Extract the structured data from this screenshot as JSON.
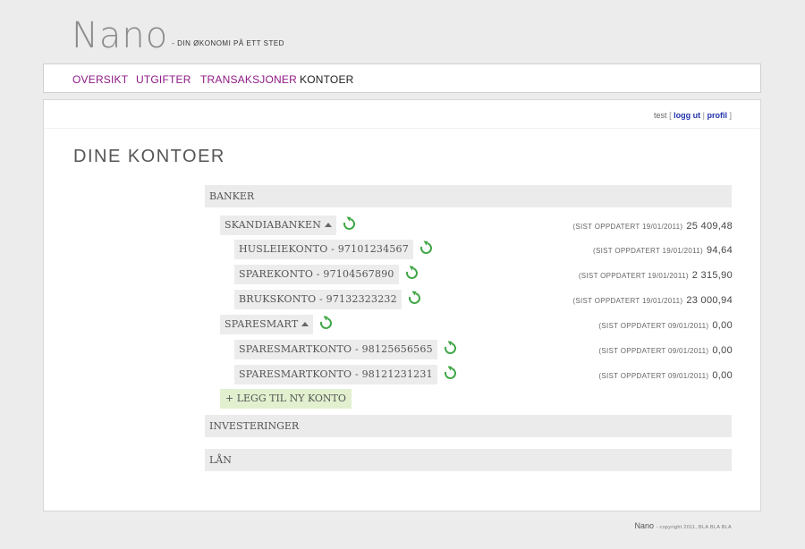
{
  "brand": {
    "name": "Nano",
    "tagline": "- DIN ØKONOMI PÅ ETT STED"
  },
  "nav": [
    {
      "label": "OVERSIKT",
      "active": false
    },
    {
      "label": "UTGIFTER",
      "active": false
    },
    {
      "label": "TRANSAKSJONER",
      "active": false
    },
    {
      "label": "KONTOER",
      "active": true
    }
  ],
  "user": {
    "name": "test",
    "logout": "logg ut",
    "profile": "profil",
    "open": "[",
    "sep": "|",
    "close": "]"
  },
  "page_title": "DINE KONTOER",
  "sections": {
    "banks": "BANKER",
    "investments": "INVESTERINGER",
    "loans": "LÅN"
  },
  "banks": [
    {
      "name": "SKANDIABANKEN",
      "updated": "(SIST OPPDATERT 19/01/2011)",
      "amount": "25 409,48",
      "accounts": [
        {
          "name": "HUSLEIEKONTO - 97101234567",
          "updated": "(SIST OPPDATERT 19/01/2011)",
          "amount": "94,64"
        },
        {
          "name": "SPAREKONTO - 97104567890",
          "updated": "(SIST OPPDATERT 19/01/2011)",
          "amount": "2 315,90"
        },
        {
          "name": "BRUKSKONTO - 97132323232",
          "updated": "(SIST OPPDATERT 19/01/2011)",
          "amount": "23 000,94"
        }
      ]
    },
    {
      "name": "SPARESMART",
      "updated": "(SIST OPPDATERT 09/01/2011)",
      "amount": "0,00",
      "accounts": [
        {
          "name": "SPARESMARTKONTO - 98125656565",
          "updated": "(SIST OPPDATERT 09/01/2011)",
          "amount": "0,00"
        },
        {
          "name": "SPARESMARTKONTO - 98121231231",
          "updated": "(SIST OPPDATERT 09/01/2011)",
          "amount": "0,00"
        }
      ]
    }
  ],
  "add_account": "+ LEGG TIL NY KONTO",
  "footer": {
    "brand": "Nano",
    "text": "- copyright 2011, BLA BLA BLA"
  },
  "colors": {
    "nav_link": "#8e1a86",
    "refresh": "#3fa644",
    "add_bg": "#e2f0cf",
    "user_link": "#2233aa"
  },
  "icons": {
    "refresh": "refresh-icon",
    "expand": "caret-up-icon"
  }
}
